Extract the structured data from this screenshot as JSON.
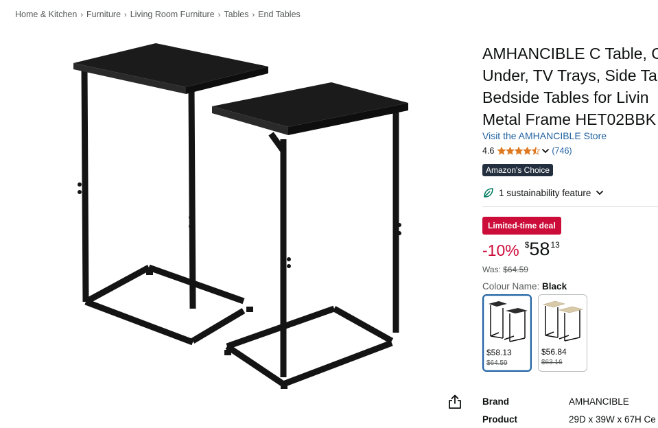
{
  "breadcrumb": [
    "Home & Kitchen",
    "Furniture",
    "Living Room Furniture",
    "Tables",
    "End Tables"
  ],
  "breadcrumb_separator": "›",
  "product": {
    "title_lines": [
      "AMHANCIBLE C Table, C",
      "Under, TV Trays, Side Ta",
      "Bedside Tables for Livin",
      "Metal Frame HET02BBK"
    ],
    "store_link": "Visit the AMHANCIBLE Store",
    "rating": "4.6",
    "stars": 4.5,
    "review_count": "(746)",
    "badge": "Amazon's Choice",
    "sustainability": "1 sustainability feature",
    "deal_label": "Limited-time deal",
    "discount": "-10%",
    "price_currency": "$",
    "price_whole": "58",
    "price_fraction": "13",
    "was_label": "Was:",
    "was_price": "$64.59",
    "colour_label": "Colour Name:",
    "colour_value": "Black"
  },
  "swatches": [
    {
      "price": "$58.13",
      "old_price": "$64.59",
      "top_color": "#2b2b2b",
      "selected": true
    },
    {
      "price": "$56.84",
      "old_price": "$63.16",
      "top_color": "#d8c9a8",
      "selected": false
    }
  ],
  "specs": [
    {
      "key": "Brand",
      "value": "AMHANCIBLE"
    },
    {
      "key": "Product",
      "value": "29D x 39W x 67H Ce"
    }
  ],
  "colors": {
    "link": "#2162a1",
    "deal": "#cc0c39",
    "badge": "#232f3e",
    "star": "#de7921",
    "table": "#1c1c1c"
  }
}
